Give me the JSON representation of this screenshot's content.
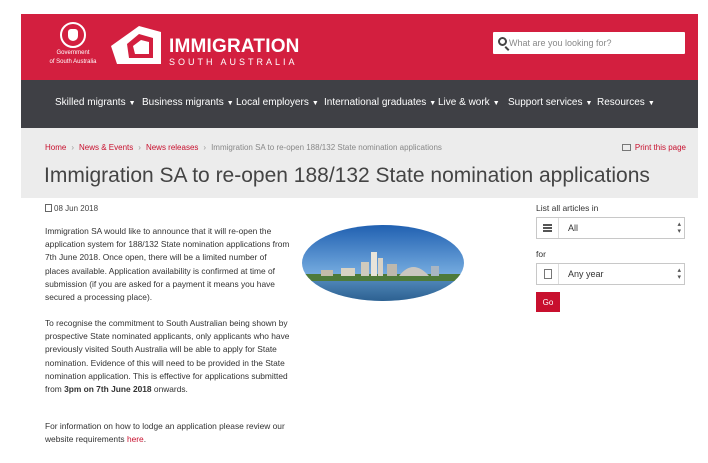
{
  "header": {
    "gov_line1": "Government",
    "gov_line2": "of South Australia",
    "brand_title": "IMMIGRATION",
    "brand_subtitle": "SOUTH AUSTRALIA",
    "search_placeholder": "What are you looking for?",
    "colors": {
      "header_bg": "#d31f3f",
      "nav_bg": "#3f4045",
      "accent": "#c8102e"
    }
  },
  "nav": {
    "items": [
      {
        "label": "Skilled migrants"
      },
      {
        "label": "Business migrants"
      },
      {
        "label": "Local employers"
      },
      {
        "label": "International graduates"
      },
      {
        "label": "Live & work"
      },
      {
        "label": "Support services"
      },
      {
        "label": "Resources"
      }
    ]
  },
  "breadcrumb": {
    "items": [
      "Home",
      "News & Events",
      "News releases"
    ],
    "current": "Immigration SA to re-open 188/132 State nomination applications",
    "print_label": "Print this page"
  },
  "page_title": "Immigration SA to re-open 188/132 State nomination applications",
  "article": {
    "date": "08 Jun 2018",
    "p1": "Immigration SA would like to announce that it will re-open the application system for 188/132 State nomination applications from 7th June 2018. Once open, there will be a limited number of places available. Application availability is confirmed at time of submission (if you are asked for a payment it means you have secured a processing place).",
    "p2_before": "To recognise the commitment to South Australian being shown by prospective State nominated applicants, only applicants who have previously visited South Australia will be able to apply for State nomination. Evidence of this will need to be provided in the State nomination application. This is effective for applications submitted from ",
    "p2_bold": "3pm on 7th June 2018",
    "p2_after": " onwards.",
    "p3_before": "For information on how to lodge an application please review our website requirements ",
    "p3_link": "here",
    "p3_after": "."
  },
  "sidebar": {
    "list_label": "List all articles in",
    "category_value": "All",
    "for_label": "for",
    "year_value": "Any year",
    "go_label": "Go"
  }
}
